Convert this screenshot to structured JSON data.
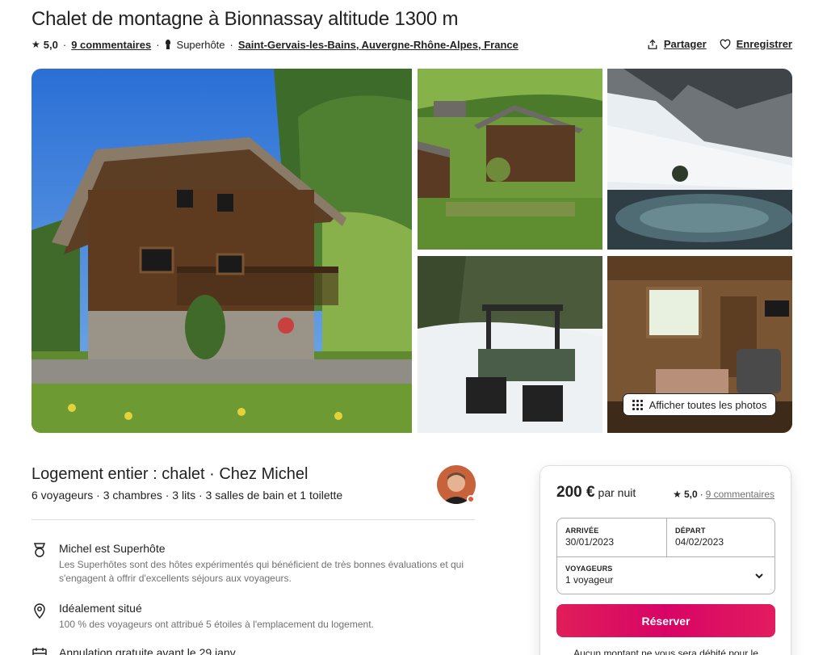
{
  "listing": {
    "title": "Chalet de montagne à Bionnassay altitude 1300 m",
    "rating": "5,0",
    "reviews": "9 commentaires",
    "superhost": "Superhôte",
    "location": "Saint-Gervais-les-Bains, Auvergne-Rhône-Alpes, France"
  },
  "actions": {
    "share": "Partager",
    "save": "Enregistrer"
  },
  "gallery": {
    "show_all": "Afficher toutes les photos"
  },
  "host": {
    "title": "Logement entier : chalet · Chez Michel",
    "subtitle": "6 voyageurs · 3 chambres · 3 lits · 3 salles de bain et 1 toilette"
  },
  "features": [
    {
      "title": "Michel est Superhôte",
      "desc": "Les Superhôtes sont des hôtes expérimentés qui bénéficient de très bonnes évaluations et qui s'engagent à offrir d'excellents séjours aux voyageurs."
    },
    {
      "title": "Idéalement situé",
      "desc": "100 % des voyageurs ont attribué 5 étoiles à l'emplacement du logement."
    },
    {
      "title": "Annulation gratuite avant le 29 janv.",
      "desc": ""
    }
  ],
  "booking": {
    "price": "200 €",
    "price_unit": "par nuit",
    "rating": "5,0",
    "reviews": "9 commentaires",
    "checkin_label": "ARRIVÉE",
    "checkin": "30/01/2023",
    "checkout_label": "DÉPART",
    "checkout": "04/02/2023",
    "guests_label": "VOYAGEURS",
    "guests": "1 voyageur",
    "reserve": "Réserver",
    "note": "Aucun montant ne vous sera débité pour le"
  },
  "colors": {
    "accent": "#e31c5f",
    "text": "#222222",
    "muted": "#717171"
  }
}
